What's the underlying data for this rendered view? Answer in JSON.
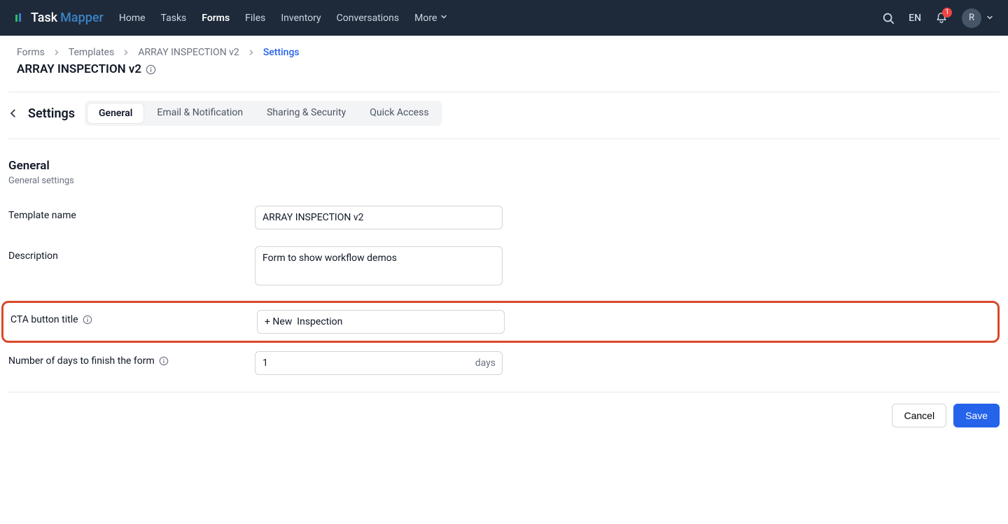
{
  "brand": {
    "part1": "Task",
    "part2": "Mapper"
  },
  "nav": {
    "home": "Home",
    "tasks": "Tasks",
    "forms": "Forms",
    "files": "Files",
    "inventory": "Inventory",
    "conversations": "Conversations",
    "more": "More"
  },
  "topright": {
    "lang": "EN",
    "notif_count": "1",
    "avatar_letter": "R"
  },
  "breadcrumb": {
    "forms": "Forms",
    "templates": "Templates",
    "template_name": "ARRAY INSPECTION v2",
    "settings": "Settings"
  },
  "page_title": "ARRAY INSPECTION v2",
  "settings_header": "Settings",
  "tabs": {
    "general": "General",
    "email": "Email & Notification",
    "sharing": "Sharing & Security",
    "quick": "Quick Access"
  },
  "section": {
    "title": "General",
    "subtitle": "General settings"
  },
  "labels": {
    "template_name": "Template name",
    "description": "Description",
    "cta": "CTA button title",
    "days": "Number of days to finish the form",
    "days_suffix": "days"
  },
  "values": {
    "template_name": "ARRAY INSPECTION v2",
    "description": "Form to show workflow demos",
    "cta": "+ New  Inspection",
    "days": "1"
  },
  "buttons": {
    "cancel": "Cancel",
    "save": "Save"
  }
}
